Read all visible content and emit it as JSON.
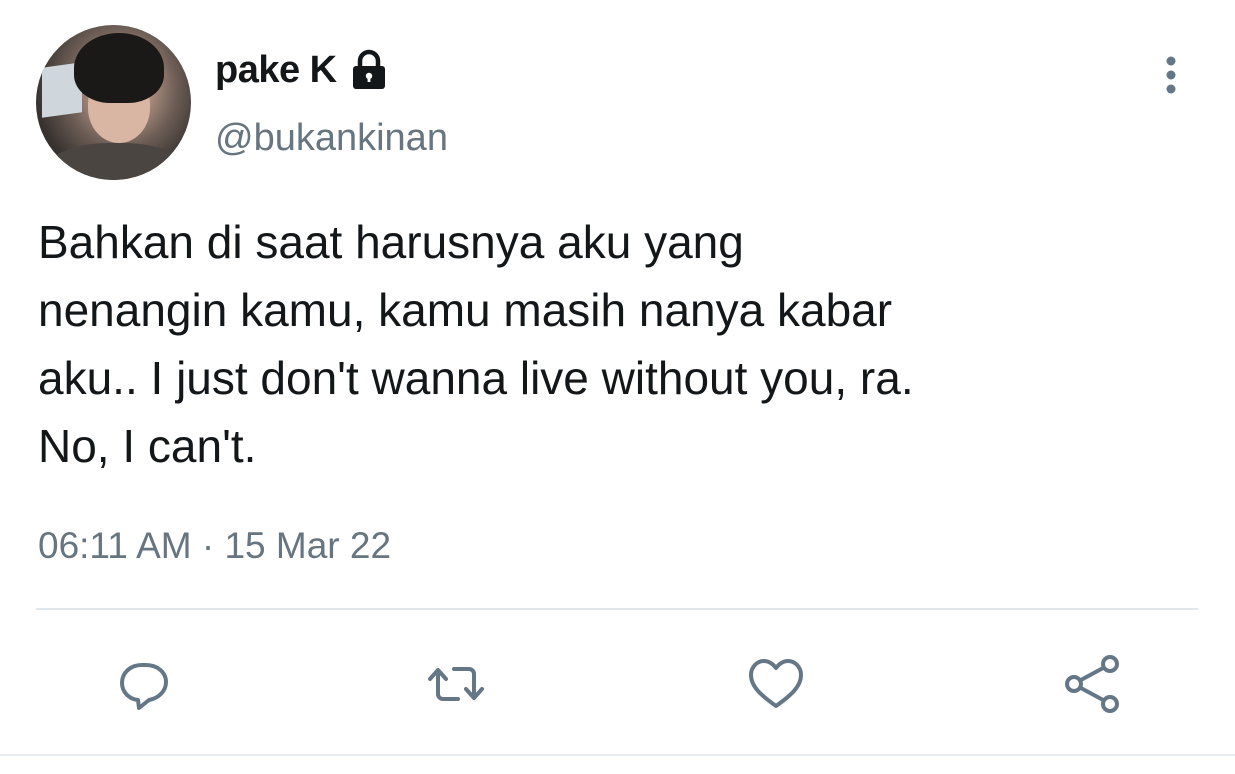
{
  "user": {
    "display_name": "pake K",
    "handle": "@bukankinan",
    "protected_icon": "lock-icon",
    "avatar": "profile-photo"
  },
  "tweet": {
    "text": "Bahkan di saat harusnya aku yang\nnenangin kamu, kamu masih nanya kabar\naku.. I just don't wanna live without you, ra.\nNo, I can't.",
    "timestamp": "06:11 AM · 15 Mar 22"
  },
  "menu": {
    "icon": "more-vertical-icon"
  },
  "actions": [
    {
      "icon": "reply-icon"
    },
    {
      "icon": "retweet-icon"
    },
    {
      "icon": "like-icon"
    },
    {
      "icon": "share-icon"
    }
  ],
  "colors": {
    "text_primary": "#14171a",
    "text_secondary": "#66757f",
    "icon": "#657786",
    "divider": "#e1e8ed"
  }
}
